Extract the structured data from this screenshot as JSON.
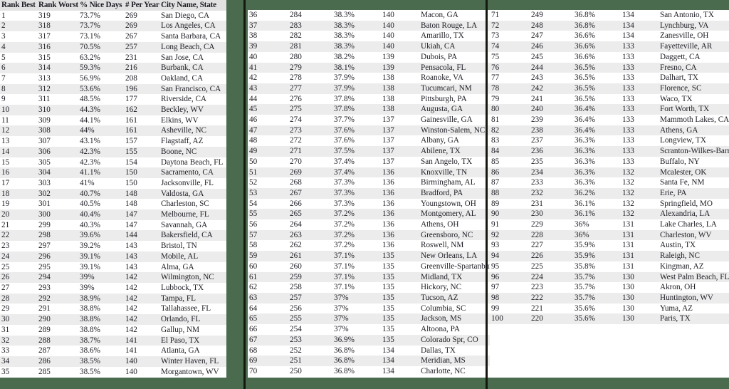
{
  "table": {
    "headers": [
      "Rank Best",
      "Rank Worst",
      "% Nice Days",
      "# Per Year",
      "City Name, State"
    ],
    "colors": {
      "background": "#4a6b4d",
      "divider": "#14180f",
      "row_odd": "#ffffff",
      "row_even": "#ececec",
      "header_bg": "#e2e2e2",
      "text": "#1c1c24"
    },
    "panels": [
      {
        "name": "panel-ranks-1-35",
        "has_header": true,
        "rows": [
          [
            "1",
            "319",
            "73.7%",
            "269",
            "San Diego, CA"
          ],
          [
            "2",
            "318",
            "73.7%",
            "269",
            "Los Angeles, CA"
          ],
          [
            "3",
            "317",
            "73.1%",
            "267",
            "Santa Barbara, CA"
          ],
          [
            "4",
            "316",
            "70.5%",
            "257",
            "Long Beach, CA"
          ],
          [
            "5",
            "315",
            "63.2%",
            "231",
            "San Jose, CA"
          ],
          [
            "6",
            "314",
            "59.3%",
            "216",
            "Burbank, CA"
          ],
          [
            "7",
            "313",
            "56.9%",
            "208",
            "Oakland, CA"
          ],
          [
            "8",
            "312",
            "53.6%",
            "196",
            "San Francisco, CA"
          ],
          [
            "9",
            "311",
            "48.5%",
            "177",
            "Riverside, CA"
          ],
          [
            "10",
            "310",
            "44.3%",
            "162",
            "Beckley, WV"
          ],
          [
            "11",
            "309",
            "44.1%",
            "161",
            "Elkins, WV"
          ],
          [
            "12",
            "308",
            "44%",
            "161",
            "Asheville, NC"
          ],
          [
            "13",
            "307",
            "43.1%",
            "157",
            "Flagstaff, AZ"
          ],
          [
            "14",
            "306",
            "42.3%",
            "155",
            "Boone, NC"
          ],
          [
            "15",
            "305",
            "42.3%",
            "154",
            "Daytona Beach, FL"
          ],
          [
            "16",
            "304",
            "41.1%",
            "150",
            "Sacramento, CA"
          ],
          [
            "17",
            "303",
            "41%",
            "150",
            "Jacksonville, FL"
          ],
          [
            "18",
            "302",
            "40.7%",
            "148",
            "Valdosta, GA"
          ],
          [
            "19",
            "301",
            "40.5%",
            "148",
            "Charleston, SC"
          ],
          [
            "20",
            "300",
            "40.4%",
            "147",
            "Melbourne, FL"
          ],
          [
            "21",
            "299",
            "40.3%",
            "147",
            "Savannah, GA"
          ],
          [
            "22",
            "298",
            "39.6%",
            "144",
            "Bakersfield, CA"
          ],
          [
            "23",
            "297",
            "39.2%",
            "143",
            "Bristol, TN"
          ],
          [
            "24",
            "296",
            "39.1%",
            "143",
            "Mobile, AL"
          ],
          [
            "25",
            "295",
            "39.1%",
            "143",
            "Alma, GA"
          ],
          [
            "26",
            "294",
            "39%",
            "142",
            "Wilmington, NC"
          ],
          [
            "27",
            "293",
            "39%",
            "142",
            "Lubbock, TX"
          ],
          [
            "28",
            "292",
            "38.9%",
            "142",
            "Tampa, FL"
          ],
          [
            "29",
            "291",
            "38.8%",
            "142",
            "Tallahassee, FL"
          ],
          [
            "30",
            "290",
            "38.8%",
            "142",
            "Orlando, FL"
          ],
          [
            "31",
            "289",
            "38.8%",
            "142",
            "Gallup, NM"
          ],
          [
            "32",
            "288",
            "38.7%",
            "141",
            "El Paso, TX"
          ],
          [
            "33",
            "287",
            "38.6%",
            "141",
            "Atlanta, GA"
          ],
          [
            "34",
            "286",
            "38.5%",
            "140",
            "Winter Haven, FL"
          ],
          [
            "35",
            "285",
            "38.5%",
            "140",
            "Morgantown, WV"
          ]
        ]
      },
      {
        "name": "panel-ranks-36-70",
        "has_header": false,
        "rows": [
          [
            "36",
            "284",
            "38.3%",
            "140",
            "Macon, GA"
          ],
          [
            "37",
            "283",
            "38.3%",
            "140",
            "Baton Rouge, LA"
          ],
          [
            "38",
            "282",
            "38.3%",
            "140",
            "Amarillo, TX"
          ],
          [
            "39",
            "281",
            "38.3%",
            "140",
            "Ukiah, CA"
          ],
          [
            "40",
            "280",
            "38.2%",
            "139",
            "Dubois, PA"
          ],
          [
            "41",
            "279",
            "38.1%",
            "139",
            "Pensacola, FL"
          ],
          [
            "42",
            "278",
            "37.9%",
            "138",
            "Roanoke, VA"
          ],
          [
            "43",
            "277",
            "37.9%",
            "138",
            "Tucumcari, NM"
          ],
          [
            "44",
            "276",
            "37.8%",
            "138",
            "Pittsburgh, PA"
          ],
          [
            "45",
            "275",
            "37.8%",
            "138",
            "Augusta, GA"
          ],
          [
            "46",
            "274",
            "37.7%",
            "137",
            "Gainesville, GA"
          ],
          [
            "47",
            "273",
            "37.6%",
            "137",
            "Winston-Salem, NC"
          ],
          [
            "48",
            "272",
            "37.6%",
            "137",
            "Albany, GA"
          ],
          [
            "49",
            "271",
            "37.5%",
            "137",
            "Abilene, TX"
          ],
          [
            "50",
            "270",
            "37.4%",
            "137",
            "San Angelo, TX"
          ],
          [
            "51",
            "269",
            "37.4%",
            "136",
            "Knoxville, TN"
          ],
          [
            "52",
            "268",
            "37.3%",
            "136",
            "Birmingham, AL"
          ],
          [
            "53",
            "267",
            "37.3%",
            "136",
            "Bradford, PA"
          ],
          [
            "54",
            "266",
            "37.3%",
            "136",
            "Youngstown, OH"
          ],
          [
            "55",
            "265",
            "37.2%",
            "136",
            "Montgomery, AL"
          ],
          [
            "56",
            "264",
            "37.2%",
            "136",
            "Athens, OH"
          ],
          [
            "57",
            "263",
            "37.2%",
            "136",
            "Greensboro, NC"
          ],
          [
            "58",
            "262",
            "37.2%",
            "136",
            "Roswell, NM"
          ],
          [
            "59",
            "261",
            "37.1%",
            "135",
            "New Orleans, LA"
          ],
          [
            "60",
            "260",
            "37.1%",
            "135",
            "Greenville-Spartanburg, SC"
          ],
          [
            "61",
            "259",
            "37.1%",
            "135",
            "Midland, TX"
          ],
          [
            "62",
            "258",
            "37.1%",
            "135",
            "Hickory, NC"
          ],
          [
            "63",
            "257",
            "37%",
            "135",
            "Tucson, AZ"
          ],
          [
            "64",
            "256",
            "37%",
            "135",
            "Columbia, SC"
          ],
          [
            "65",
            "255",
            "37%",
            "135",
            "Jackson, MS"
          ],
          [
            "66",
            "254",
            "37%",
            "135",
            "Altoona, PA"
          ],
          [
            "67",
            "253",
            "36.9%",
            "135",
            "Colorado Spr, CO"
          ],
          [
            "68",
            "252",
            "36.8%",
            "134",
            "Dallas, TX"
          ],
          [
            "69",
            "251",
            "36.8%",
            "134",
            "Meridian, MS"
          ],
          [
            "70",
            "250",
            "36.8%",
            "134",
            "Charlotte, NC"
          ]
        ]
      },
      {
        "name": "panel-ranks-71-100",
        "has_header": false,
        "rows": [
          [
            "71",
            "249",
            "36.8%",
            "134",
            "San Antonio, TX"
          ],
          [
            "72",
            "248",
            "36.8%",
            "134",
            "Lynchburg, VA"
          ],
          [
            "73",
            "247",
            "36.6%",
            "134",
            "Zanesville, OH"
          ],
          [
            "74",
            "246",
            "36.6%",
            "133",
            "Fayetteville, AR"
          ],
          [
            "75",
            "245",
            "36.6%",
            "133",
            "Daggett, CA"
          ],
          [
            "76",
            "244",
            "36.5%",
            "133",
            "Fresno, CA"
          ],
          [
            "77",
            "243",
            "36.5%",
            "133",
            "Dalhart, TX"
          ],
          [
            "78",
            "242",
            "36.5%",
            "133",
            "Florence, SC"
          ],
          [
            "79",
            "241",
            "36.5%",
            "133",
            "Waco, TX"
          ],
          [
            "80",
            "240",
            "36.4%",
            "133",
            "Fort Worth, TX"
          ],
          [
            "81",
            "239",
            "36.4%",
            "133",
            "Mammoth Lakes, CA"
          ],
          [
            "82",
            "238",
            "36.4%",
            "133",
            "Athens, GA"
          ],
          [
            "83",
            "237",
            "36.3%",
            "133",
            "Longview, TX"
          ],
          [
            "84",
            "236",
            "36.3%",
            "133",
            "Scranton-Wilkes-Barre, PA"
          ],
          [
            "85",
            "235",
            "36.3%",
            "133",
            "Buffalo, NY"
          ],
          [
            "86",
            "234",
            "36.3%",
            "132",
            "Mcalester, OK"
          ],
          [
            "87",
            "233",
            "36.3%",
            "132",
            "Santa Fe, NM"
          ],
          [
            "88",
            "232",
            "36.2%",
            "132",
            "Erie, PA"
          ],
          [
            "89",
            "231",
            "36.1%",
            "132",
            "Springfield, MO"
          ],
          [
            "90",
            "230",
            "36.1%",
            "132",
            "Alexandria, LA"
          ],
          [
            "91",
            "229",
            "36%",
            "131",
            "Lake Charles, LA"
          ],
          [
            "92",
            "228",
            "36%",
            "131",
            "Charleston, WV"
          ],
          [
            "93",
            "227",
            "35.9%",
            "131",
            "Austin, TX"
          ],
          [
            "94",
            "226",
            "35.9%",
            "131",
            "Raleigh, NC"
          ],
          [
            "95",
            "225",
            "35.8%",
            "131",
            "Kingman, AZ"
          ],
          [
            "96",
            "224",
            "35.7%",
            "130",
            "West Palm Beach, FL"
          ],
          [
            "97",
            "223",
            "35.7%",
            "130",
            "Akron, OH"
          ],
          [
            "98",
            "222",
            "35.7%",
            "130",
            "Huntington, WV"
          ],
          [
            "99",
            "221",
            "35.6%",
            "130",
            "Yuma, AZ"
          ],
          [
            "100",
            "220",
            "35.6%",
            "130",
            "Paris, TX"
          ]
        ]
      }
    ]
  }
}
